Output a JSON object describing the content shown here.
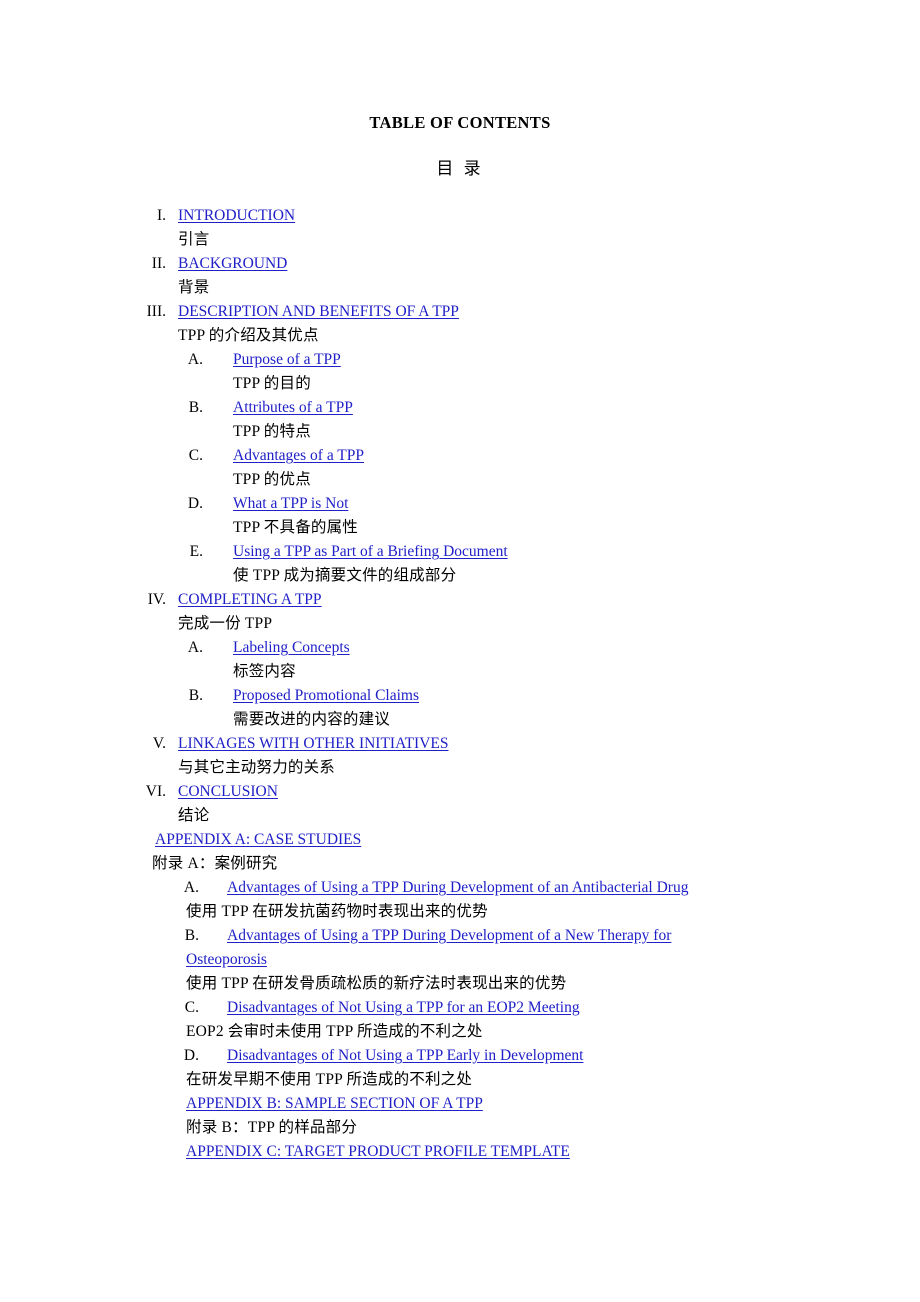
{
  "document": {
    "title_en": "TABLE OF CONTENTS",
    "title_cn": "目  录"
  },
  "toc": {
    "sections": [
      {
        "numeral": "I.",
        "link": "INTRODUCTION",
        "translation": "引言"
      },
      {
        "numeral": "II.",
        "link": "BACKGROUND",
        "translation": "背景"
      },
      {
        "numeral": "III.",
        "link": "DESCRIPTION AND BENEFITS OF A TPP ",
        "translation": "TPP 的介绍及其优点",
        "subs": [
          {
            "letter": "A.",
            "link": "Purpose of a TPP",
            "translation": "TPP 的目的"
          },
          {
            "letter": "B.",
            "link": "Attributes of a TPP",
            "translation": "TPP 的特点"
          },
          {
            "letter": "C.",
            "link": "Advantages of a TPP",
            "translation": "TPP 的优点"
          },
          {
            "letter": "D.",
            "link": "What a TPP is Not",
            "translation": "TPP 不具备的属性"
          },
          {
            "letter": "E.",
            "link": "Using a TPP as Part of a Briefing Document",
            "translation": "使 TPP 成为摘要文件的组成部分"
          }
        ]
      },
      {
        "numeral": "IV.",
        "link": "COMPLETING A TPP",
        "translation": "完成一份 TPP",
        "subs": [
          {
            "letter": "A.",
            "link": "Labeling Concepts",
            "translation": "标签内容"
          },
          {
            "letter": "B.",
            "link": "Proposed Promotional Claims",
            "translation": "需要改进的内容的建议"
          }
        ]
      },
      {
        "numeral": "V.",
        "link": "LINKAGES WITH OTHER INITIATIVES",
        "translation": "与其它主动努力的关系"
      },
      {
        "numeral": "VI.",
        "link": "CONCLUSION",
        "translation": "结论"
      }
    ],
    "appendices": [
      {
        "link": "APPENDIX A: CASE STUDIES",
        "translation": "附录 A：案例研究",
        "subs": [
          {
            "letter": "A.",
            "link": "Advantages of Using a TPP During Development of an Antibacterial Drug",
            "link_wrap": "",
            "translation": "使用 TPP 在研发抗菌药物时表现出来的优势"
          },
          {
            "letter": "B.",
            "link": "Advantages of Using a TPP During Development of a New Therapy for ",
            "link_wrap": "Osteoporosis",
            "translation": "使用 TPP 在研发骨质疏松质的新疗法时表现出来的优势"
          },
          {
            "letter": "C.",
            "link": "Disadvantages of Not Using a TPP for an EOP2 Meeting",
            "link_wrap": "",
            "translation": "EOP2 会审时未使用 TPP 所造成的不利之处"
          },
          {
            "letter": "D.",
            "link": "Disadvantages of Not Using a TPP Early in Development",
            "link_wrap": "",
            "translation": "在研发早期不使用 TPP 所造成的不利之处"
          }
        ]
      },
      {
        "link": "APPENDIX B: SAMPLE SECTION OF A TPP",
        "translation": "附录 B：TPP 的样品部分"
      },
      {
        "link": "APPENDIX C: TARGET PRODUCT PROFILE TEMPLATE",
        "translation": ""
      }
    ]
  }
}
